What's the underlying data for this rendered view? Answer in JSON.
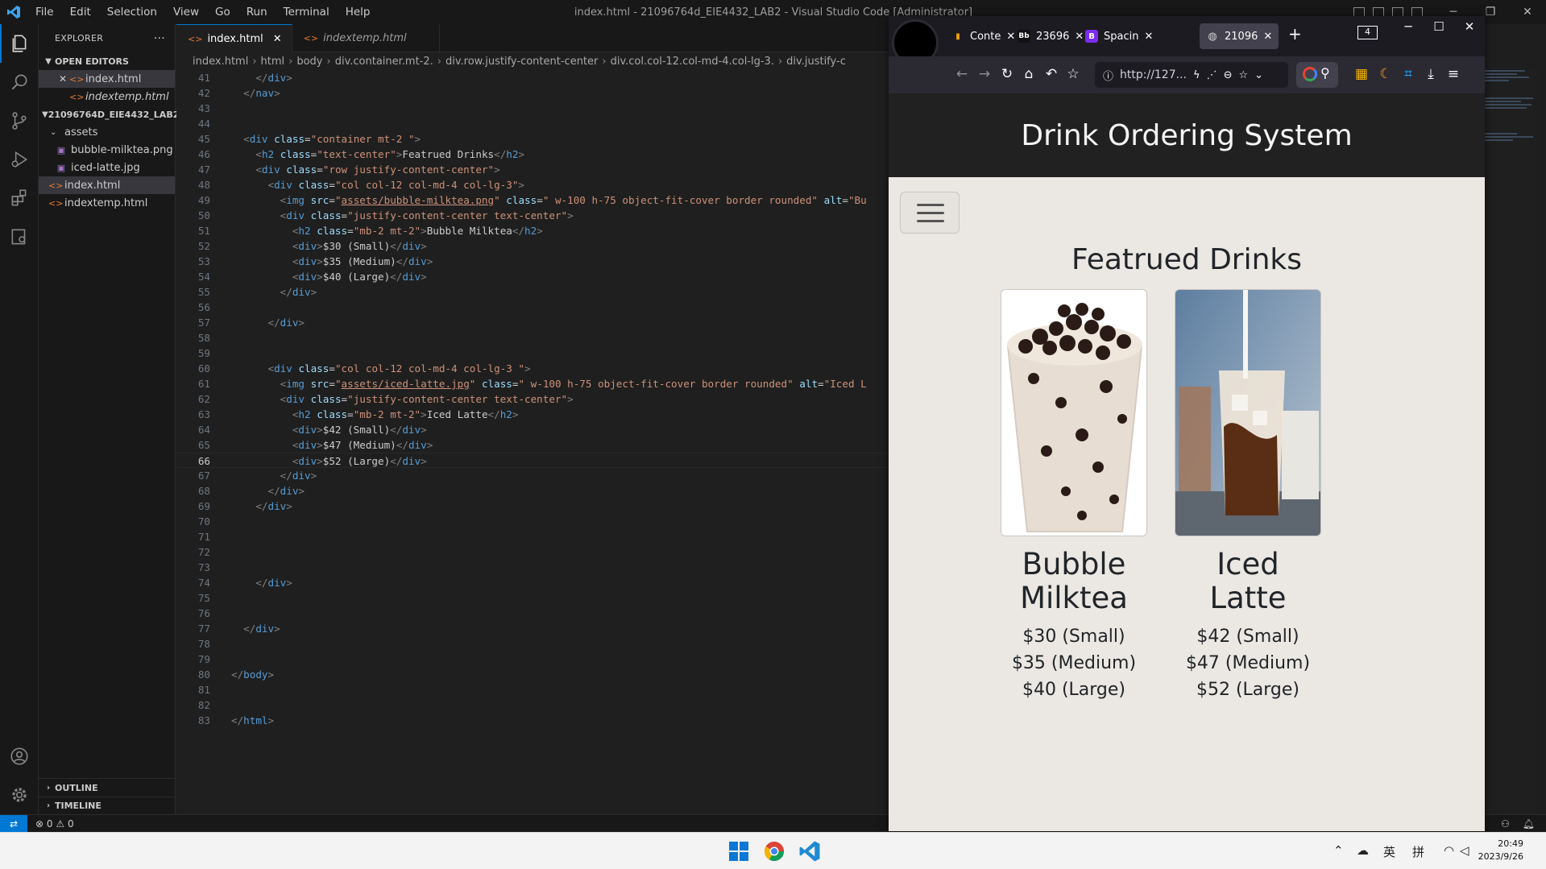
{
  "titlebar": {
    "menu": [
      "File",
      "Edit",
      "Selection",
      "View",
      "Go",
      "Run",
      "Terminal",
      "Help"
    ],
    "window_title": "index.html - 21096764d_EIE4432_LAB2 - Visual Studio Code [Administrator]"
  },
  "explorer": {
    "header": "EXPLORER",
    "open_editors_label": "OPEN EDITORS",
    "open_editors": [
      "index.html",
      "indextemp.html"
    ],
    "folder_label": "21096764D_EIE4432_LAB2",
    "assets_label": "assets",
    "asset_files": [
      "bubble-milktea.png",
      "iced-latte.jpg"
    ],
    "files": [
      "index.html",
      "indextemp.html"
    ],
    "outline_label": "OUTLINE",
    "timeline_label": "TIMELINE"
  },
  "editor": {
    "tabs": [
      "index.html",
      "indextemp.html"
    ],
    "breadcrumb": [
      "index.html",
      "html",
      "body",
      "div.container.mt-2.",
      "div.row.justify-content-center",
      "div.col.col-12.col-md-4.col-lg-3.",
      "div.justify-c"
    ],
    "current_line": 66
  },
  "statusbar": {
    "errors": "0",
    "warnings": "0"
  },
  "browser": {
    "tabs": [
      "Conte",
      "23696",
      "Spacin",
      "21096"
    ],
    "tab_count": "4",
    "url": "http://127..."
  },
  "page": {
    "site_title": "Drink Ordering System",
    "section_title": "Featrued Drinks",
    "drinks": [
      {
        "name": "Bubble Milktea",
        "prices": [
          "$30 (Small)",
          "$35 (Medium)",
          "$40 (Large)"
        ]
      },
      {
        "name": "Iced Latte",
        "prices": [
          "$42 (Small)",
          "$47 (Medium)",
          "$52 (Large)"
        ]
      }
    ]
  },
  "taskbar": {
    "ime": [
      "英",
      "拼"
    ],
    "time": "20:49",
    "date": "2023/9/26"
  }
}
